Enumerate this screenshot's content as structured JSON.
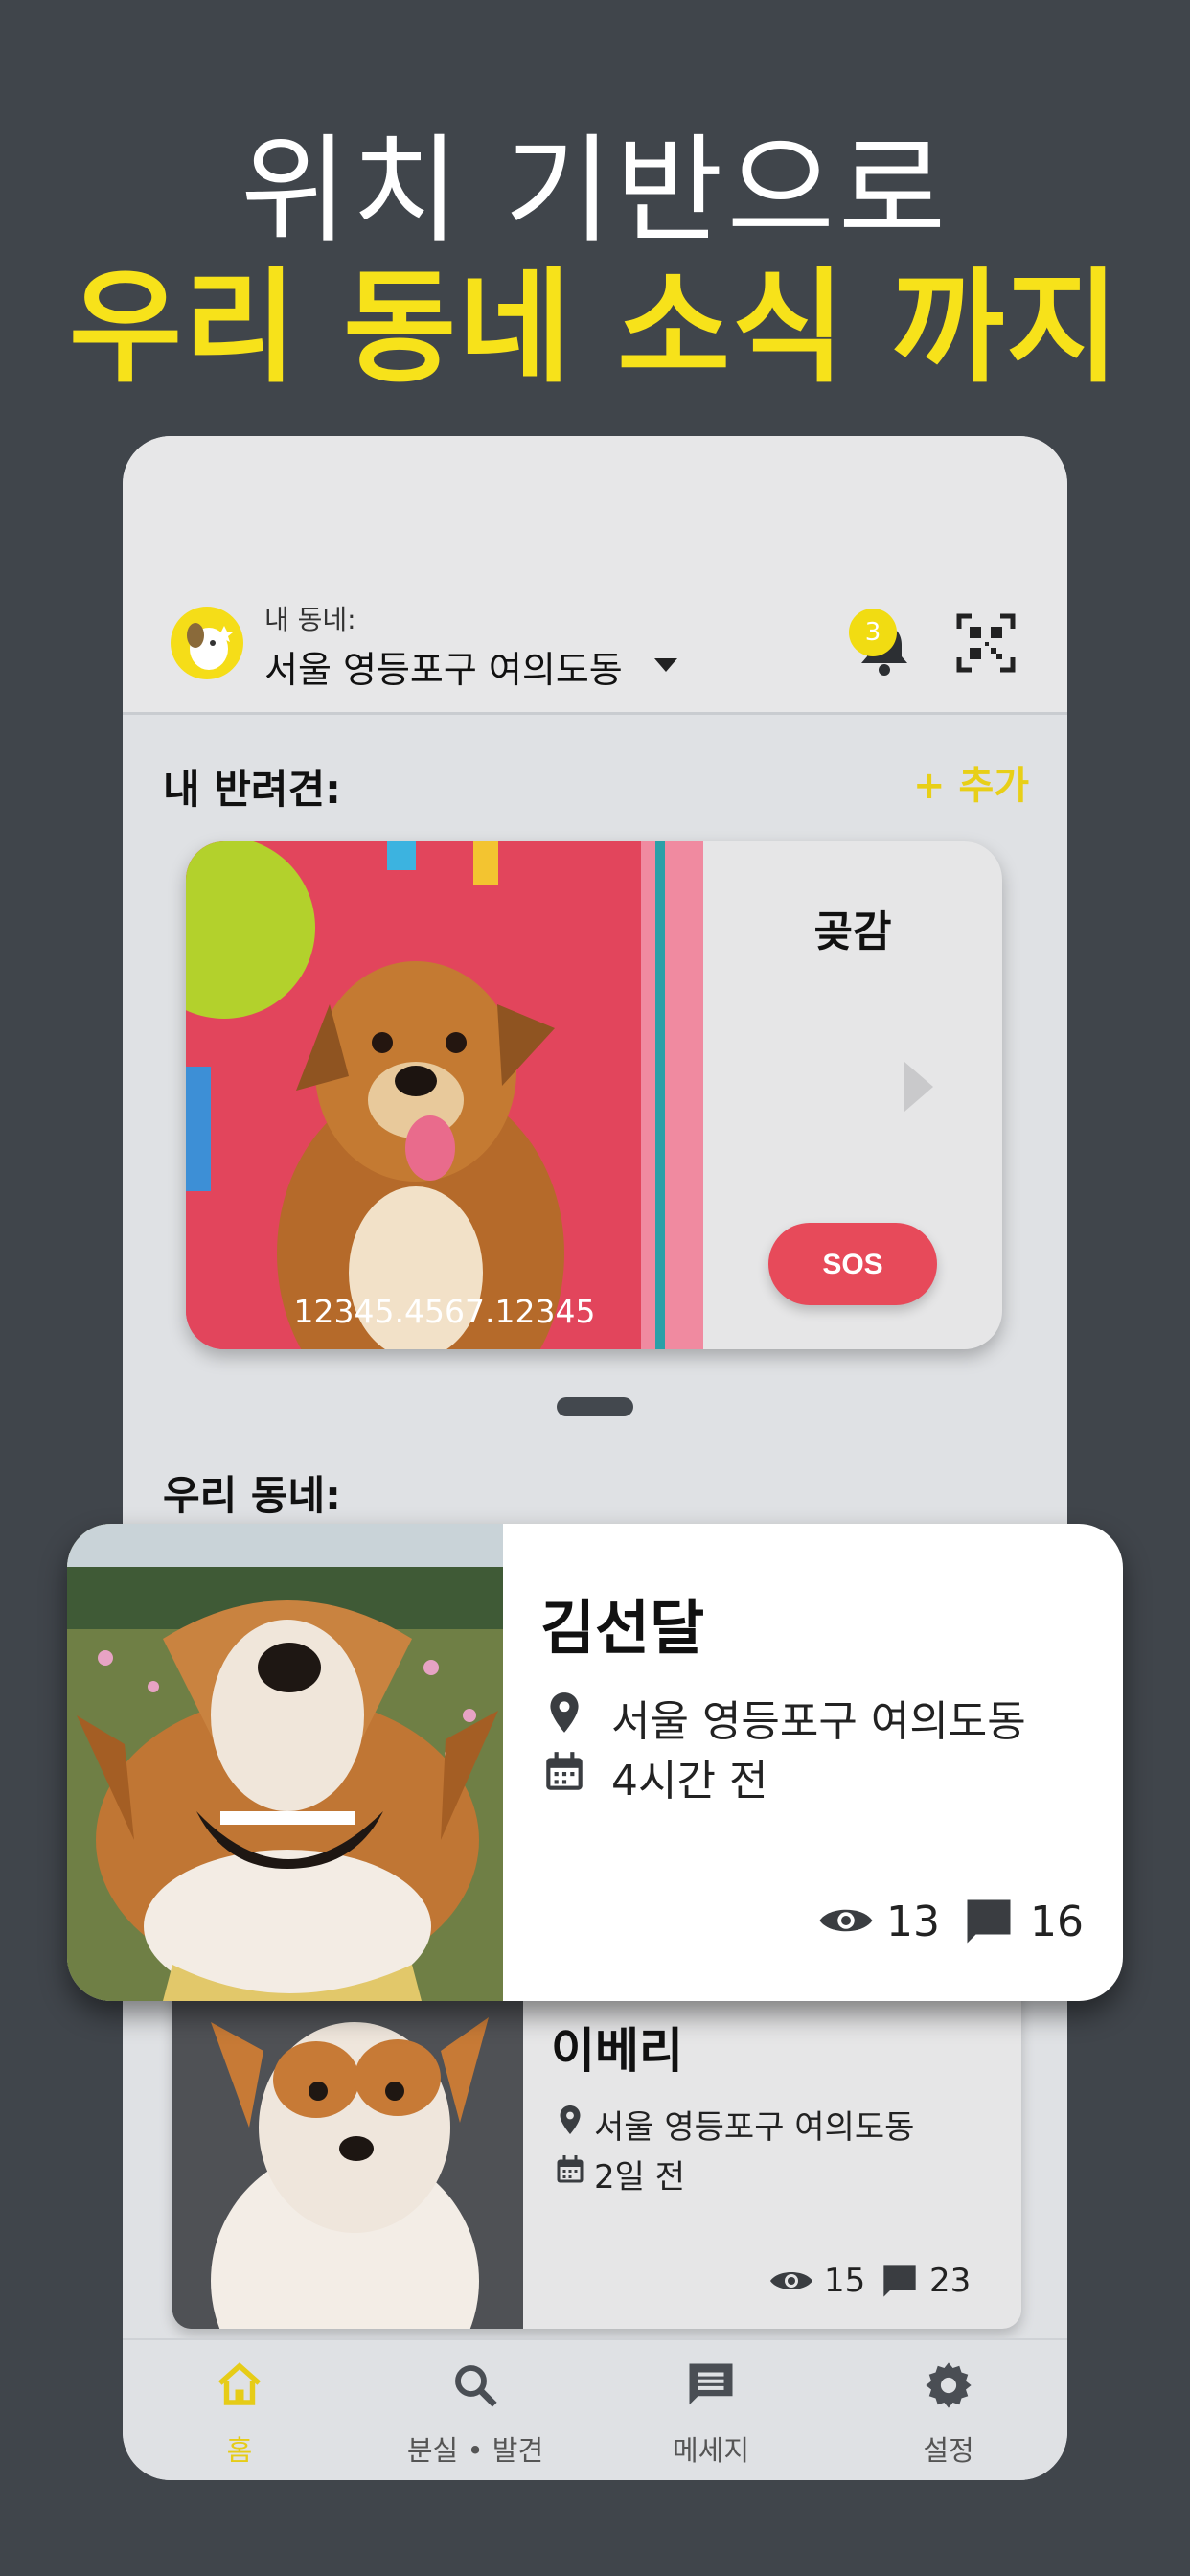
{
  "promo": {
    "line1": "위치 기반으로",
    "line2": "우리 동네 소식 까지",
    "line2_color": "#f7e21a"
  },
  "header": {
    "location_label": "내 동네:",
    "location_value": "서울 영등포구 여의도동",
    "notification_count": "3",
    "icons": [
      "dog-avatar-icon",
      "caret-down-icon",
      "bell-icon",
      "qr-code-icon"
    ]
  },
  "my_pets": {
    "title": "내 반려견:",
    "add_label": "+ 추가",
    "accent_color": "#e8cf17",
    "pet": {
      "name": "곶감",
      "registration_id": "12345.4567.12345",
      "sos_label": "SOS",
      "sos_color": "#e74a5a"
    }
  },
  "neighborhood": {
    "title": "우리 동네:",
    "posts": [
      {
        "name": "김선달",
        "location": "서울 영등포구 여의도동",
        "time": "4시간 전",
        "views": "13",
        "comments": "16"
      },
      {
        "name": "이베리",
        "location": "서울 영등포구 여의도동",
        "time": "2일 전",
        "views": "15",
        "comments": "23"
      }
    ]
  },
  "bottom_nav": {
    "items": [
      {
        "label": "홈",
        "icon": "home-icon",
        "active": true
      },
      {
        "label": "분실 • 발견",
        "icon": "search-icon",
        "active": false
      },
      {
        "label": "메세지",
        "icon": "message-icon",
        "active": false
      },
      {
        "label": "설정",
        "icon": "gear-icon",
        "active": false
      }
    ],
    "active_color": "#e6cc17"
  }
}
